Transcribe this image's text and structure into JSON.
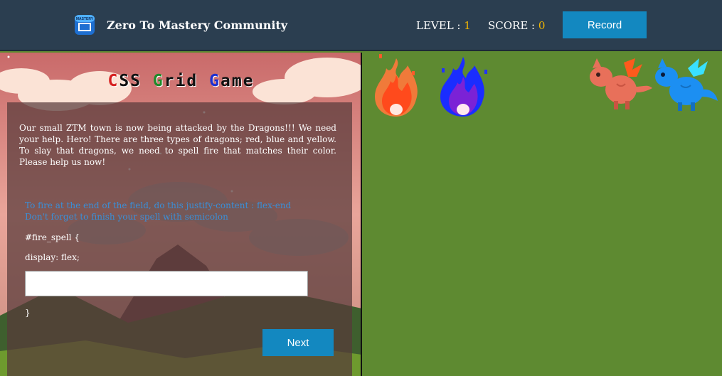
{
  "header": {
    "logo_icon": "ztm-mastery-logo",
    "logo_text": "MASTERY",
    "brand": "Zero To Mastery Community",
    "level_label": "LEVEL : ",
    "level_value": "1",
    "score_label": "SCORE : ",
    "score_value": "0",
    "record_label": "Record"
  },
  "game": {
    "title_parts": [
      {
        "letter": "C",
        "rest": "SS",
        "color": "#d62020"
      },
      {
        "letter": "G",
        "rest": "rid",
        "color": "#1f8a2a"
      },
      {
        "letter": "G",
        "rest": "ame",
        "color": "#1d2fd0"
      }
    ],
    "intro": "Our small ZTM town is now being attacked by the Dragons!!! We need your help. Hero! There are three types of dragons; red, blue and yellow. To slay that dragons, we need to spell fire that matches their color. Please help us now!",
    "hint_line1": "To fire at the end of the field, do this justify-content : flex-end",
    "hint_line2": "Don't forget to finish your spell with semicolon",
    "code_open": "#fire_spell {",
    "code_display": "display: flex;",
    "code_close": "}",
    "spell_input_value": "",
    "next_label": "Next"
  },
  "field": {
    "sprites": [
      "red-fire-icon",
      "blue-fire-icon",
      "red-dragon-icon",
      "blue-dragon-icon"
    ],
    "colors": {
      "red": "#f0582a",
      "blue": "#1a2dff",
      "dragon_red": "#e8705a",
      "dragon_blue": "#1c8ff2",
      "grass": "#5e8a31"
    }
  }
}
